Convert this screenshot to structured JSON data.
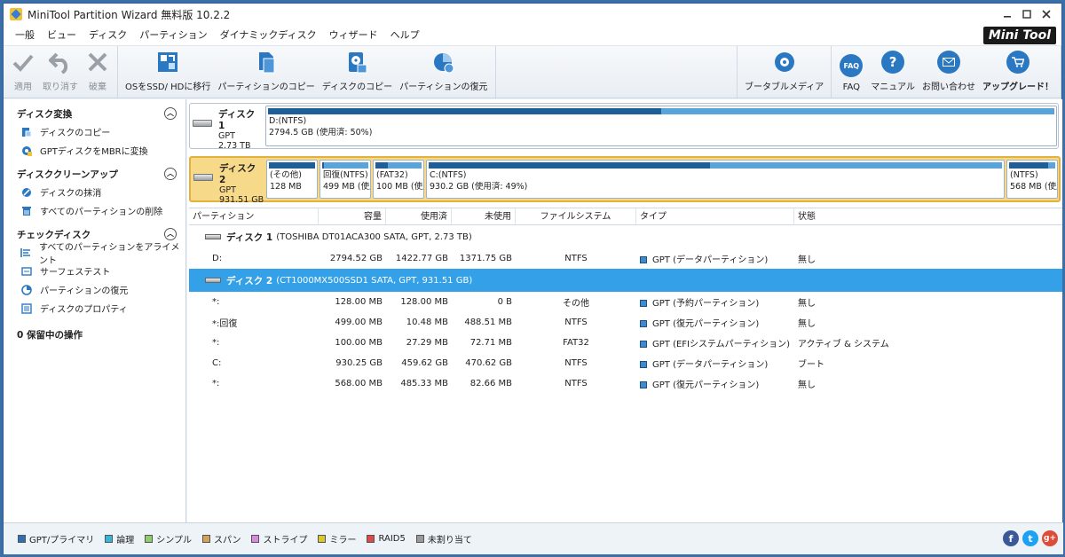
{
  "window": {
    "title": "MiniTool Partition Wizard 無料版 10.2.2"
  },
  "menu": [
    "一般",
    "ビュー",
    "ディスク",
    "パーティション",
    "ダイナミックディスク",
    "ウィザード",
    "ヘルプ"
  ],
  "brand": {
    "mini": "Mini",
    "tool": "Tool"
  },
  "toolbar": {
    "apply": "適用",
    "undo": "取り消す",
    "discard": "破棄",
    "migrate": "OSをSSD/ HDに移行",
    "copy_partition": "パーティションのコピー",
    "copy_disk": "ディスクのコピー",
    "recover": "パーティションの復元",
    "bootable": "ブータブルメディア",
    "faq": "FAQ",
    "manual": "マニュアル",
    "contact": "お問い合わせ",
    "upgrade": "アップグレード！"
  },
  "sidebar": {
    "sections": [
      {
        "title": "ディスク変換",
        "items": [
          "ディスクのコピー",
          "GPTディスクをMBRに変換"
        ]
      },
      {
        "title": "ディスククリーンアップ",
        "items": [
          "ディスクの抹消",
          "すべてのパーティションの削除"
        ]
      },
      {
        "title": "チェックディスク",
        "items": [
          "すべてのパーティションをアライメント",
          "サーフェステスト",
          "パーティションの復元",
          "ディスクのプロパティ"
        ]
      }
    ],
    "pending": "0 保留中の操作"
  },
  "disk_map": {
    "disk1": {
      "name": "ディスク 1",
      "type": "GPT",
      "size": "2.73 TB",
      "partitions": [
        {
          "line1": "D:(NTFS)",
          "line2": "2794.5 GB (使用済: 50%)",
          "used": 0.5
        }
      ]
    },
    "disk2": {
      "name": "ディスク 2",
      "type": "GPT",
      "size": "931.51 GB",
      "partitions": [
        {
          "line1": "(その他)",
          "line2": "128 MB",
          "used": 1.0
        },
        {
          "line1": "回復(NTFS)",
          "line2": "499 MB (使用",
          "used": 0.03
        },
        {
          "line1": "(FAT32)",
          "line2": "100 MB (使用",
          "used": 0.27
        },
        {
          "line1": "C:(NTFS)",
          "line2": "930.2 GB (使用済: 49%)",
          "used": 0.49
        },
        {
          "line1": "(NTFS)",
          "line2": "568 MB (使用",
          "used": 0.85
        }
      ]
    }
  },
  "table": {
    "headers": [
      "パーティション",
      "容量",
      "使用済",
      "未使用",
      "ファイルシステム",
      "タイプ",
      "状態"
    ],
    "disk1_label": "ディスク 1",
    "disk1_desc": "(TOSHIBA DT01ACA300 SATA, GPT, 2.73 TB)",
    "disk1_rows": [
      [
        "D:",
        "2794.52 GB",
        "1422.77 GB",
        "1371.75 GB",
        "NTFS",
        "GPT (データパーティション)",
        "無し"
      ]
    ],
    "disk2_label": "ディスク 2",
    "disk2_desc": "(CT1000MX500SSD1 SATA, GPT, 931.51 GB)",
    "disk2_rows": [
      [
        "*:",
        "128.00 MB",
        "128.00 MB",
        "0 B",
        "その他",
        "GPT (予約パーティション)",
        "無し"
      ],
      [
        "*:回復",
        "499.00 MB",
        "10.48 MB",
        "488.51 MB",
        "NTFS",
        "GPT (復元パーティション)",
        "無し"
      ],
      [
        "*:",
        "100.00 MB",
        "27.29 MB",
        "72.71 MB",
        "FAT32",
        "GPT (EFIシステムパーティション)",
        "アクティブ & システム"
      ],
      [
        "C:",
        "930.25 GB",
        "459.62 GB",
        "470.62 GB",
        "NTFS",
        "GPT (データパーティション)",
        "ブート"
      ],
      [
        "*:",
        "568.00 MB",
        "485.33 MB",
        "82.66 MB",
        "NTFS",
        "GPT (復元パーティション)",
        "無し"
      ]
    ]
  },
  "legend": [
    {
      "label": "GPT/プライマリ",
      "color": "#2b6fb5"
    },
    {
      "label": "論理",
      "color": "#36b6d8"
    },
    {
      "label": "シンプル",
      "color": "#8fce6a"
    },
    {
      "label": "スパン",
      "color": "#d6a25a"
    },
    {
      "label": "ストライプ",
      "color": "#d68ae0"
    },
    {
      "label": "ミラー",
      "color": "#d8c82c"
    },
    {
      "label": "RAID5",
      "color": "#e04848"
    },
    {
      "label": "未割り当て",
      "color": "#9a9a9a"
    }
  ],
  "social": {
    "facebook": "f",
    "twitter": "t",
    "google": "g+"
  }
}
